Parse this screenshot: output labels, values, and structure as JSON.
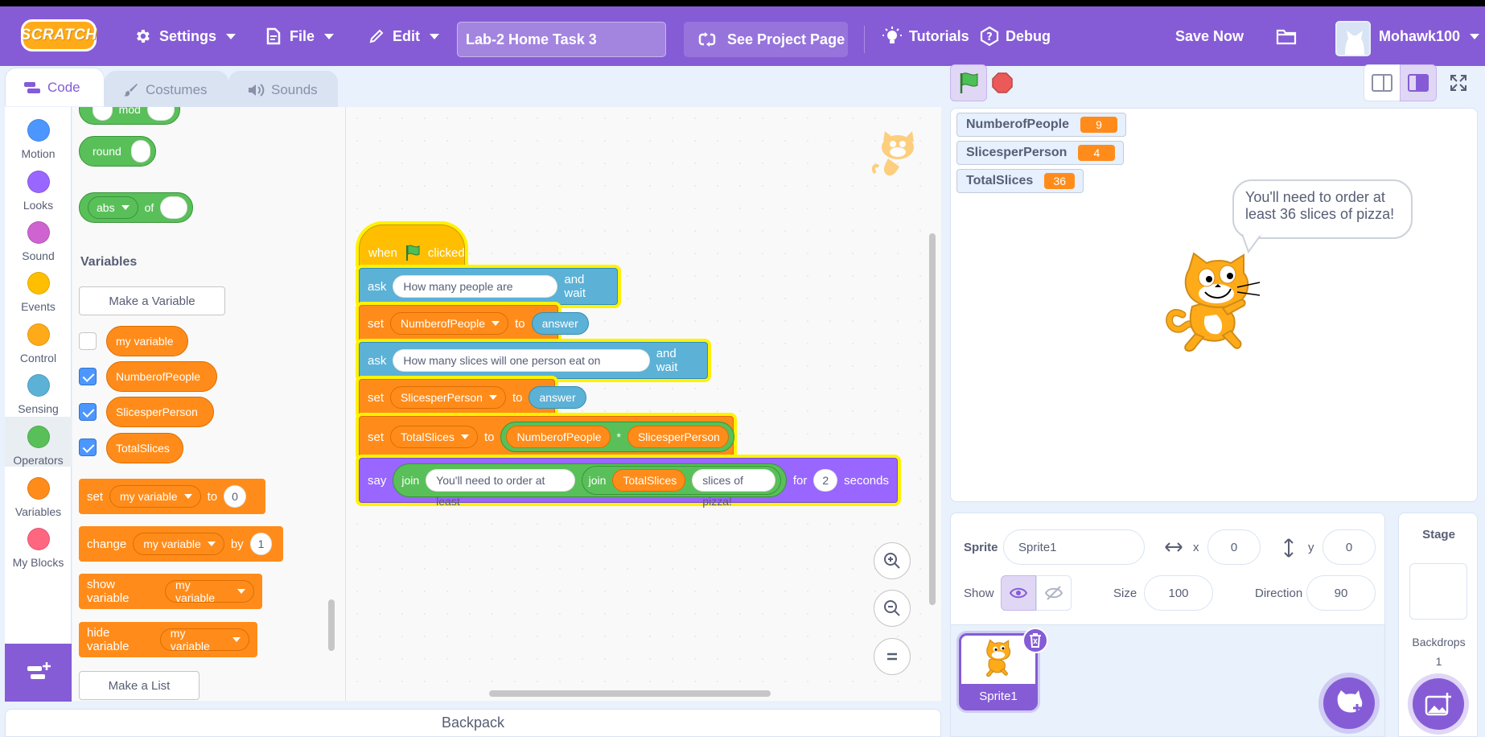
{
  "menubar": {
    "logo": "SCRATCH",
    "settings": "Settings",
    "file": "File",
    "edit": "Edit",
    "project_title": "Lab-2 Home Task 3",
    "see_project": "See Project Page",
    "tutorials": "Tutorials",
    "debug": "Debug",
    "save_now": "Save Now",
    "username": "Mohawk100"
  },
  "tabs": {
    "code": "Code",
    "costumes": "Costumes",
    "sounds": "Sounds"
  },
  "categories": [
    {
      "label": "Motion",
      "color": "#4c97ff"
    },
    {
      "label": "Looks",
      "color": "#9966ff"
    },
    {
      "label": "Sound",
      "color": "#cf63cf"
    },
    {
      "label": "Events",
      "color": "#ffbf00"
    },
    {
      "label": "Control",
      "color": "#ffab19"
    },
    {
      "label": "Sensing",
      "color": "#5cb1d6"
    },
    {
      "label": "Operators",
      "color": "#59c059"
    },
    {
      "label": "Variables",
      "color": "#ff8c1a"
    },
    {
      "label": "My Blocks",
      "color": "#ff6680"
    }
  ],
  "palette": {
    "mod": "mod",
    "round": "round",
    "abs": "abs",
    "of": "of",
    "variables_title": "Variables",
    "make_variable": "Make a Variable",
    "vars": [
      "my variable",
      "NumberofPeople",
      "SlicesperPerson",
      "TotalSlices"
    ],
    "var_checked": [
      false,
      true,
      true,
      true
    ],
    "set": "set",
    "set_var": "my variable",
    "set_to": "to",
    "set_val": "0",
    "change": "change",
    "change_var": "my variable",
    "change_by": "by",
    "change_val": "1",
    "show_var": "show variable",
    "show_var_name": "my variable",
    "hide_var": "hide variable",
    "hide_var_name": "my variable",
    "make_list": "Make a List"
  },
  "script": {
    "when": "when",
    "clicked": "clicked",
    "ask1": "ask",
    "ask1_q": "How many people are there?",
    "ask1_wait": "and wait",
    "set1": "set",
    "set1_var": "NumberofPeople",
    "set1_to": "to",
    "set1_val": "answer",
    "ask2": "ask",
    "ask2_q": "How many slices will one person eat on average?",
    "ask2_wait": "and wait",
    "set2": "set",
    "set2_var": "SlicesperPerson",
    "set2_to": "to",
    "set2_val": "answer",
    "set3": "set",
    "set3_var": "TotalSlices",
    "set3_to": "to",
    "set3_a": "NumberofPeople",
    "set3_op": "*",
    "set3_b": "SlicesperPerson",
    "say": "say",
    "join1": "join",
    "say_text": "You'll need to order at least",
    "join2": "join",
    "say_var": "TotalSlices",
    "say_text2": "slices of pizza!",
    "for": "for",
    "secs": "2",
    "seconds": "seconds"
  },
  "stage": {
    "monitors": [
      {
        "name": "NumberofPeople",
        "value": "9"
      },
      {
        "name": "SlicesperPerson",
        "value": "4"
      },
      {
        "name": "TotalSlices",
        "value": "36"
      }
    ],
    "speech": "You'll need to order at least 36 slices of pizza!"
  },
  "sprite_info": {
    "sprite_label": "Sprite",
    "sprite_name": "Sprite1",
    "x_label": "x",
    "x": "0",
    "y_label": "y",
    "y": "0",
    "show_label": "Show",
    "size_label": "Size",
    "size": "100",
    "direction_label": "Direction",
    "direction": "90"
  },
  "sprite_list": {
    "sprite1": "Sprite1"
  },
  "stage_panel": {
    "title": "Stage",
    "backdrops_label": "Backdrops",
    "backdrops_count": "1"
  },
  "backpack": "Backpack"
}
